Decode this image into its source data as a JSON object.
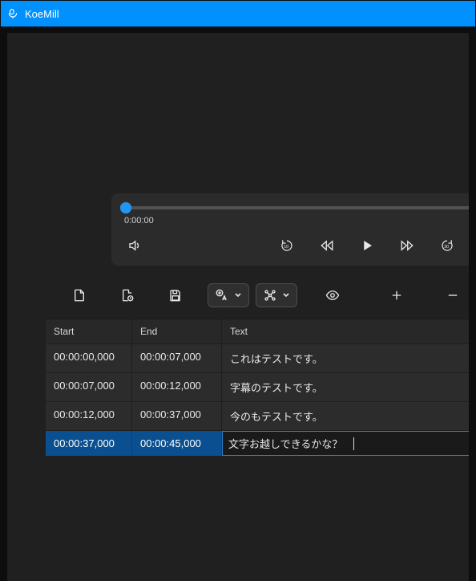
{
  "app": {
    "title": "KoeMill"
  },
  "player": {
    "current_time": "0:00:00",
    "icons": {
      "volume": "speaker-icon",
      "back10": "rewind-10-icon",
      "rewind": "rewind-icon",
      "play": "play-icon",
      "forward": "fast-forward-icon",
      "fwd30": "forward-30-icon",
      "next": "next-icon"
    }
  },
  "toolbar": {
    "icons": {
      "file": "file-icon",
      "file_lock": "file-lock-icon",
      "save": "save-icon",
      "translate": "translate-icon",
      "graph": "graph-icon",
      "eye": "eye-icon",
      "add": "plus-icon",
      "remove": "minus-icon"
    }
  },
  "table": {
    "columns": {
      "start": "Start",
      "end": "End",
      "text": "Text"
    },
    "rows": [
      {
        "start": "00:00:00,000",
        "end": "00:00:07,000",
        "text": "これはテストです。"
      },
      {
        "start": "00:00:07,000",
        "end": "00:00:12,000",
        "text": "字幕のテストです。"
      },
      {
        "start": "00:00:12,000",
        "end": "00:00:37,000",
        "text": "今のもテストです。"
      },
      {
        "start": "00:00:37,000",
        "end": "00:00:45,000",
        "text": "文字お越しできるかな？"
      }
    ],
    "selected_index": 3
  }
}
